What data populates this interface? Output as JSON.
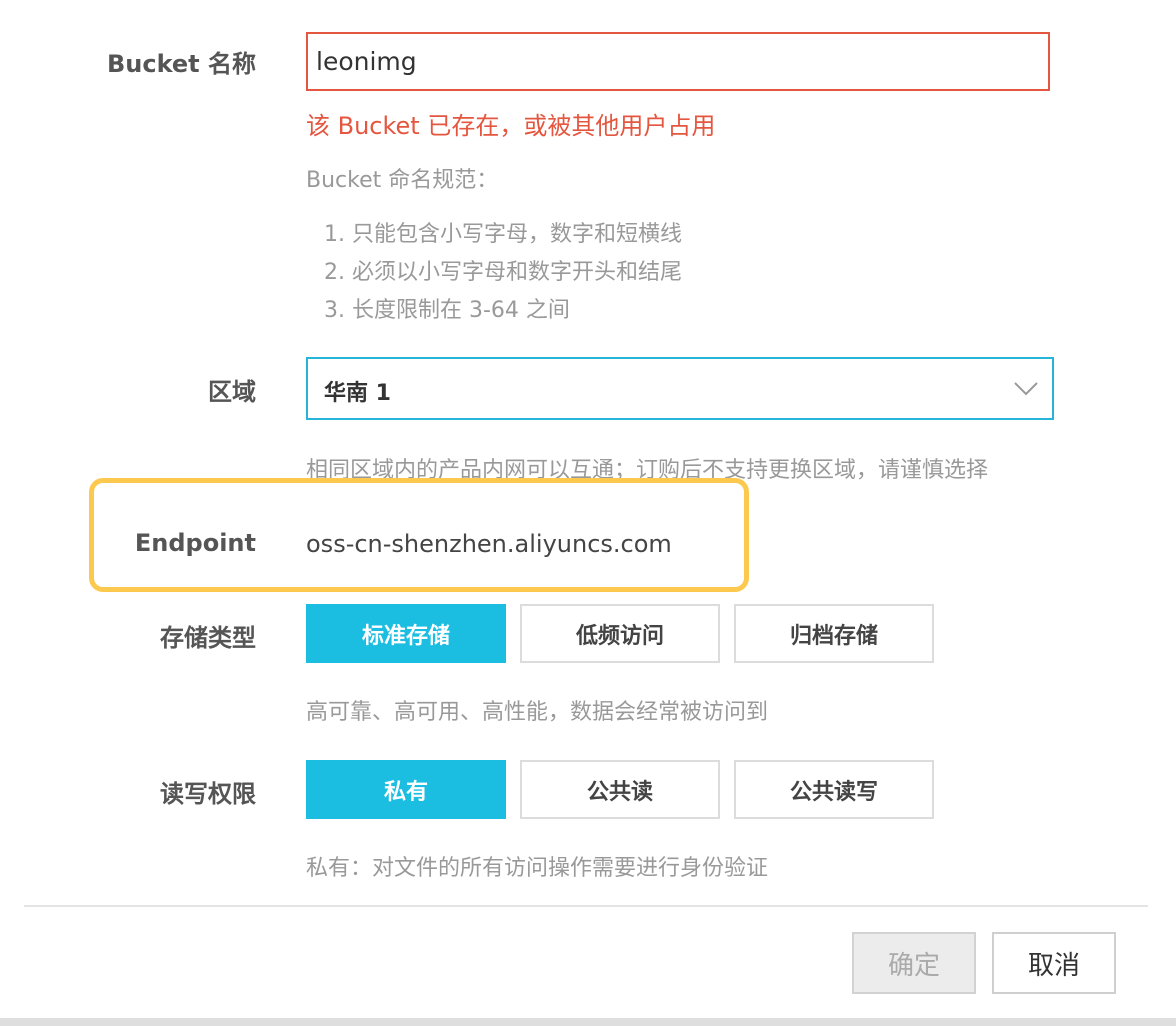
{
  "bucket_name": {
    "label": "Bucket 名称",
    "value": "leonimg",
    "error": "该 Bucket 已存在，或被其他用户占用",
    "rules_title": "Bucket 命名规范：",
    "rules": [
      "1. 只能包含小写字母，数字和短横线",
      "2. 必须以小写字母和数字开头和结尾",
      "3. 长度限制在 3-64 之间"
    ]
  },
  "region": {
    "label": "区域",
    "selected": "华南 1",
    "hint": "相同区域内的产品内网可以互通；订购后不支持更换区域，请谨慎选择"
  },
  "endpoint": {
    "label": "Endpoint",
    "value": "oss-cn-shenzhen.aliyuncs.com"
  },
  "storage_class": {
    "label": "存储类型",
    "options": [
      "标准存储",
      "低频访问",
      "归档存储"
    ],
    "selected_index": 0,
    "hint": "高可靠、高可用、高性能，数据会经常被访问到"
  },
  "acl": {
    "label": "读写权限",
    "options": [
      "私有",
      "公共读",
      "公共读写"
    ],
    "selected_index": 0,
    "hint": "私有：对文件的所有访问操作需要进行身份验证"
  },
  "footer": {
    "confirm_label": "确定",
    "cancel_label": "取消"
  },
  "colors": {
    "accent": "#1bbde0",
    "error": "#e4563f",
    "highlight": "#fcc94e"
  },
  "icons": {
    "select_arrow": "chevron-down-icon"
  }
}
